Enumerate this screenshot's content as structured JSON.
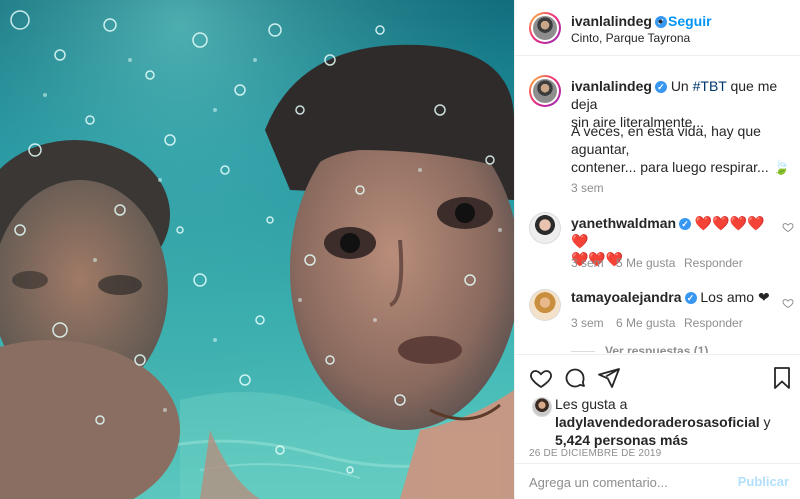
{
  "post": {
    "author": "ivanlalindeg",
    "follow_label": "Seguir",
    "separator": "•",
    "location": "Cinto, Parque Tayrona"
  },
  "caption": {
    "username": "ivanlalindeg",
    "line1_pre": "Un ",
    "hashtag": "#TBT",
    "line1_post": " que me deja",
    "line2": "sin aire literalmente...",
    "line3": "A veces, en esta vida, hay que aguantar,",
    "line4": "contener... para luego respirar... 🍃",
    "time": "3 sem"
  },
  "comments": [
    {
      "username": "yanethwaldman",
      "text_line1": "❤️❤️❤️❤️❤️",
      "text_line2": "❤️❤️❤️",
      "time": "3 sem",
      "likes": "5 Me gusta",
      "reply": "Responder"
    },
    {
      "username": "tamayoalejandra",
      "text_line1": "Los amo ❤",
      "time": "3 sem",
      "likes": "6 Me gusta",
      "reply": "Responder"
    }
  ],
  "view_replies": "Ver respuestas (1)",
  "likes": {
    "prefix": "Les gusta a",
    "user": "ladylavendedoraderosasoficial",
    "conj": " y",
    "others": "5,424 personas más"
  },
  "date": "26 DE DICIEMBRE DE 2019",
  "comment_input": {
    "placeholder": "Agrega un comentario..."
  },
  "publish_label": "Publicar",
  "colors": {
    "link_blue": "#0095f6",
    "verified_blue": "#3897f0",
    "heart_red": "#ed4956",
    "publish_disabled": "#b2dffc"
  }
}
